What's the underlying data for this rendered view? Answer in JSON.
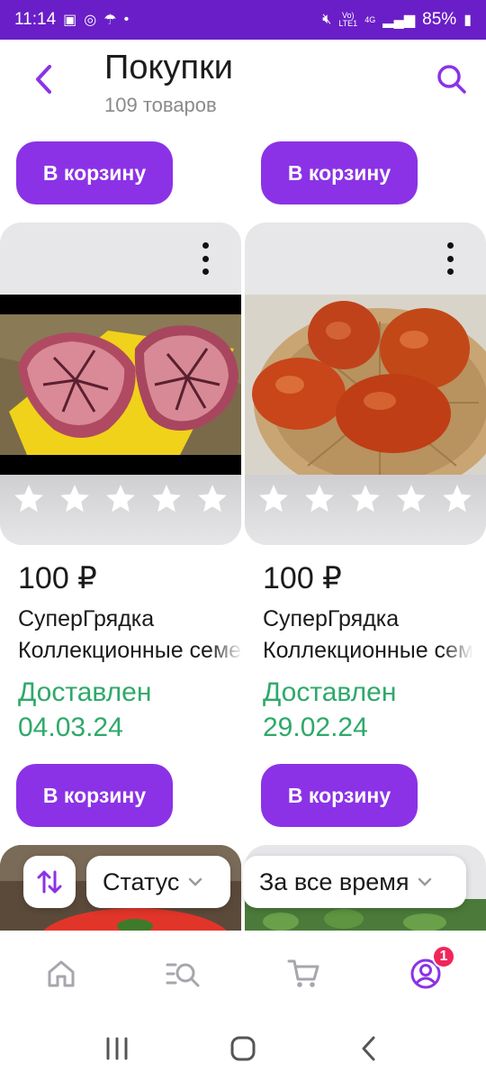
{
  "status_bar": {
    "time": "11:14",
    "network_top": "Vo)",
    "network_bottom": "LTE1",
    "gen_top": "4G",
    "battery": "85%"
  },
  "header": {
    "title": "Покупки",
    "subtitle": "109 товаров"
  },
  "top_buttons": {
    "cart_label": "В корзину"
  },
  "products": [
    {
      "price": "100 ₽",
      "brand": "СуперГрядка",
      "name": "Коллекционные семена",
      "status_label": "Доставлен",
      "status_date": "04.03.24",
      "rating": 0,
      "cart_label": "В корзину"
    },
    {
      "price": "100 ₽",
      "brand": "СуперГрядка",
      "name": "Коллекционные семена",
      "status_label": "Доставлен",
      "status_date": "29.02.24",
      "rating": 0,
      "cart_label": "В корзину"
    }
  ],
  "filters": {
    "status_label": "Статус",
    "period_label": "За все время"
  },
  "bottom_nav": {
    "items": [
      "home-icon",
      "catalog-search-icon",
      "cart-icon",
      "profile-icon"
    ],
    "profile_badge": "1"
  },
  "colors": {
    "accent": "#8b32e6",
    "status_bar": "#6a1ec8",
    "delivered": "#2ea96a",
    "badge": "#f0265a"
  }
}
